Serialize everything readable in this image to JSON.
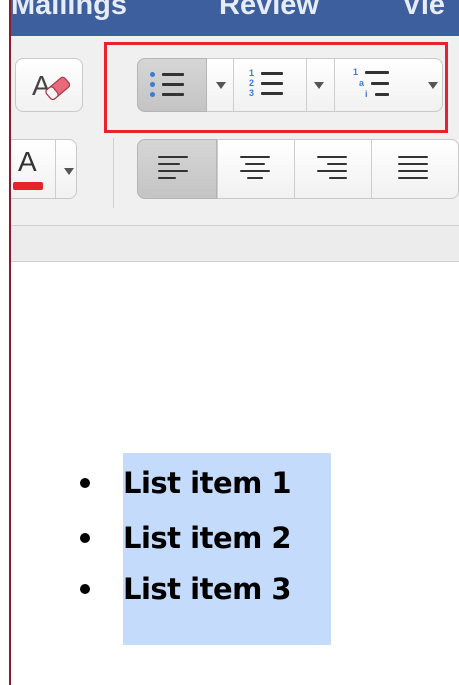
{
  "window": {
    "frame_color": "#8b1c2c",
    "tabbar_color": "#3d5f9e"
  },
  "menu_tabs": [
    {
      "label": "Mailings"
    },
    {
      "label": "Review"
    },
    {
      "label": "Vie"
    }
  ],
  "toolbar": {
    "clear_formatting_icon": "eraser-letter-a-icon",
    "font_color": {
      "letter": "A",
      "underline_color": "#e8222d"
    },
    "list_buttons": [
      {
        "name": "bullets",
        "icon": "bulleted-list-icon",
        "active": true
      },
      {
        "name": "numbering",
        "icon": "numbered-list-icon",
        "active": false
      },
      {
        "name": "multilevel",
        "icon": "multilevel-list-icon",
        "active": false
      }
    ],
    "numbering_digits": [
      "1",
      "2",
      "3"
    ],
    "multilevel_marks": [
      "1",
      "a",
      "i"
    ],
    "align_buttons": [
      {
        "name": "align-left",
        "active": true
      },
      {
        "name": "align-center",
        "active": false
      },
      {
        "name": "align-right",
        "active": false
      },
      {
        "name": "justify",
        "active": false
      }
    ],
    "highlight_color": "#e8222d"
  },
  "document": {
    "list_items": [
      {
        "text": "List item 1"
      },
      {
        "text": "List item 2"
      },
      {
        "text": "List item 3"
      }
    ],
    "selection_color": "#c4dbfb"
  }
}
